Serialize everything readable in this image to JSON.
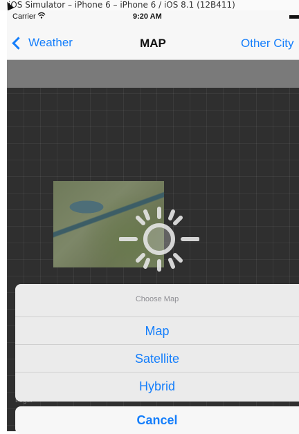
{
  "simulator": {
    "title": "iOS Simulator – iPhone 6 – iPhone 6 / iOS 8.1 (12B411)"
  },
  "status_bar": {
    "carrier": "Carrier",
    "time": "9:20 AM",
    "wifi_icon": "wifi-icon",
    "battery_icon": "battery-icon"
  },
  "nav_bar": {
    "back_label": "Weather",
    "title": "MAP",
    "right_label": "Other City"
  },
  "map": {
    "legal_label": "Legal",
    "spinner_icon": "loading-spinner-icon"
  },
  "action_sheet": {
    "header": "Choose Map",
    "options": [
      "Map",
      "Satellite",
      "Hybrid"
    ],
    "cancel_label": "Cancel"
  },
  "colors": {
    "accent": "#147efb",
    "map_background": "#2f2f2f",
    "sheet_background": "#ebebeb"
  }
}
